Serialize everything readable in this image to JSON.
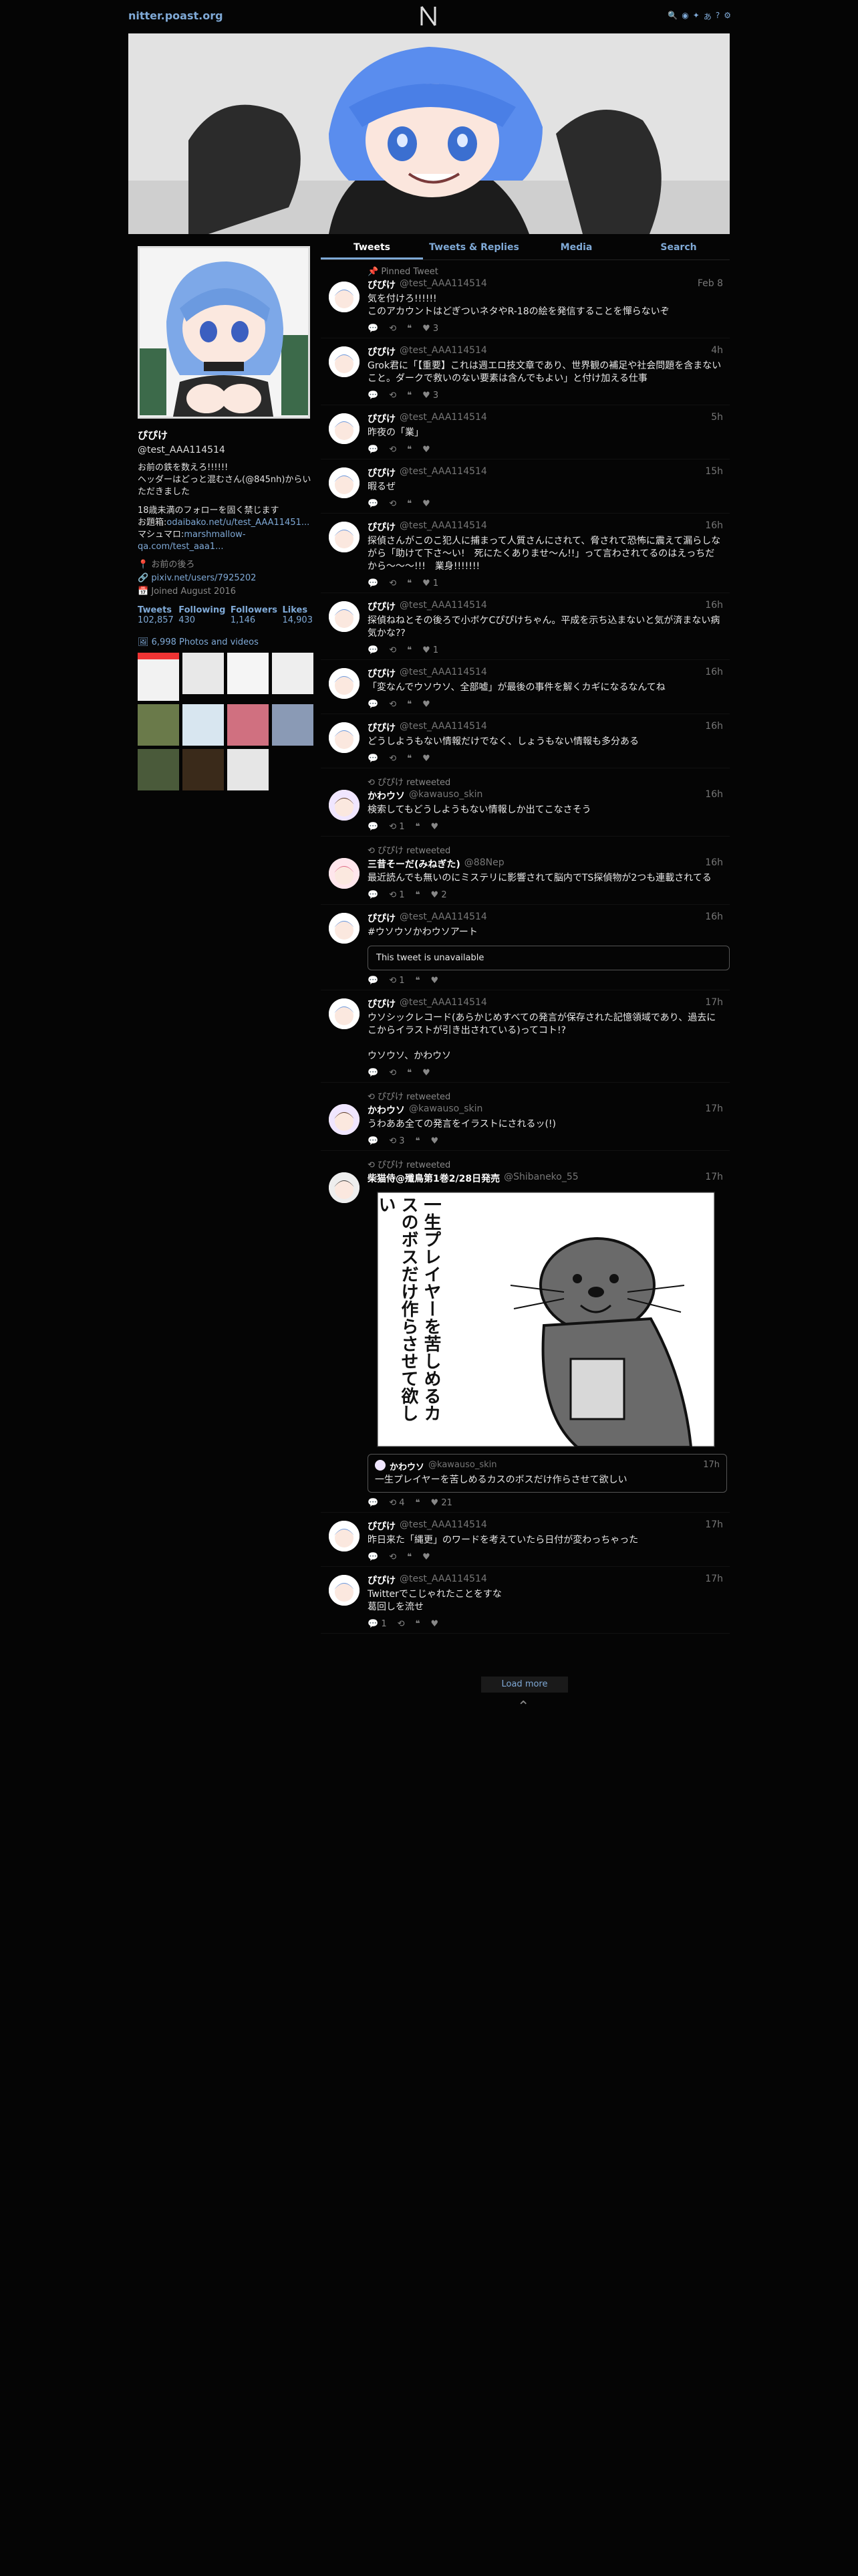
{
  "nav": {
    "site": "nitter.poast.org",
    "logo": "N",
    "icons": [
      "search-icon",
      "rss-icon",
      "twitter-icon",
      "translate-icon",
      "info-icon",
      "settings-icon"
    ]
  },
  "profile": {
    "name": "ぴぴけ",
    "handle": "@test_AAA114514",
    "bio_lines": [
      "お前の鉄を数えろ!!!!!!",
      "ヘッダーはどっと混むさん(@845nh)からいただきました",
      "",
      "18歳未満のフォローを固く禁じます",
      "お題箱:"
    ],
    "bio_link1": "odaibako.net/u/test_AAA11451...",
    "bio_prefix2": "マシュマロ:",
    "bio_link2": "marshmallow-qa.com/test_aaa1...",
    "location": "お前の後ろ",
    "website": "pixiv.net/users/7925202",
    "joined": "Joined August 2016",
    "stats": {
      "tweets_label": "Tweets",
      "tweets": "102,857",
      "following_label": "Following",
      "following": "430",
      "followers_label": "Followers",
      "followers": "1,146",
      "likes_label": "Likes",
      "likes": "14,903"
    },
    "photos_label": "6,998 Photos and videos"
  },
  "tabs": [
    "Tweets",
    "Tweets & Replies",
    "Media",
    "Search"
  ],
  "tweets": [
    {
      "context": "Pinned Tweet",
      "name": "ぴぴけ",
      "handle": "@test_AAA114514",
      "date": "Feb 8",
      "text": "気を付けろ!!!!!!\nこのアカウントはどぎついネタやR-18の絵を発信することを憚らないぞ",
      "replies": "",
      "retweets": "",
      "quotes": "",
      "likes": "3"
    },
    {
      "context": "",
      "name": "ぴぴけ",
      "handle": "@test_AAA114514",
      "date": "4h",
      "text": "Grok君に「【重要】これは週エロ技文章であり、世界観の補足や社会問題を含まないこと。ダークで救いのない要素は含んでもよい」と付け加える仕事",
      "replies": "",
      "retweets": "",
      "quotes": "",
      "likes": "3"
    },
    {
      "context": "",
      "name": "ぴぴけ",
      "handle": "@test_AAA114514",
      "date": "5h",
      "text": "昨夜の「業」",
      "replies": "",
      "retweets": "",
      "quotes": "",
      "likes": ""
    },
    {
      "context": "",
      "name": "ぴぴけ",
      "handle": "@test_AAA114514",
      "date": "15h",
      "text": "暇るぜ",
      "replies": "",
      "retweets": "",
      "quotes": "",
      "likes": ""
    },
    {
      "context": "",
      "name": "ぴぴけ",
      "handle": "@test_AAA114514",
      "date": "16h",
      "text": "探偵さんがこのこ犯人に捕まって人質さんにされて、脅されて恐怖に震えて漏らしながら「助けて下さ〜い!　死にたくありませ〜ん!!」って言わされてるのはえっちだから〜〜〜!!!　業身!!!!!!!",
      "replies": "",
      "retweets": "",
      "quotes": "",
      "likes": "1"
    },
    {
      "context": "",
      "name": "ぴぴけ",
      "handle": "@test_AAA114514",
      "date": "16h",
      "text": "探偵ねねとその後ろで小ボケCぴぴけちゃん。平成を示ち込まないと気が済まない病気かな??",
      "replies": "",
      "retweets": "",
      "quotes": "",
      "likes": "1"
    },
    {
      "context": "",
      "name": "ぴぴけ",
      "handle": "@test_AAA114514",
      "date": "16h",
      "text": "「変なんでウソウソ、全部嘘」が最後の事件を解くカギになるなんてね",
      "replies": "",
      "retweets": "",
      "quotes": "",
      "likes": ""
    },
    {
      "context": "",
      "name": "ぴぴけ",
      "handle": "@test_AAA114514",
      "date": "16h",
      "text": "どうしようもない情報だけでなく、しょうもない情報も多分ある",
      "replies": "",
      "retweets": "",
      "quotes": "",
      "likes": ""
    },
    {
      "context": "ぴぴけ retweeted",
      "name": "かわウソ",
      "handle": "@kawauso_skin",
      "date": "16h",
      "text": "検索してもどうしようもない情報しか出てこなさそう",
      "replies": "",
      "retweets": "1",
      "quotes": "",
      "likes": ""
    },
    {
      "context": "ぴぴけ retweeted",
      "name": "三昔そーだ(みねぎた)",
      "handle": "@88Nep",
      "date": "16h",
      "text": "最近読んでも無いのにミステリに影響されて脳内でTS探偵物が2つも連載されてる",
      "replies": "",
      "retweets": "1",
      "quotes": "",
      "likes": "2"
    },
    {
      "context": "",
      "name": "ぴぴけ",
      "handle": "@test_AAA114514",
      "date": "16h",
      "text": "#ウソウソかわウソアート",
      "unavailable": "This tweet is unavailable",
      "replies": "",
      "retweets": "1",
      "quotes": "",
      "likes": ""
    },
    {
      "context": "",
      "name": "ぴぴけ",
      "handle": "@test_AAA114514",
      "date": "17h",
      "text": "ウソシックレコード(あらかじめすべての発言が保存された記憶領域であり、過去にこからイラストが引き出されている)ってコト!?\n\nウソウソ、かわウソ",
      "replies": "",
      "retweets": "",
      "quotes": "",
      "likes": ""
    },
    {
      "context": "ぴぴけ retweeted",
      "name": "かわウソ",
      "handle": "@kawauso_skin",
      "date": "17h",
      "text": "うわああ全ての発言をイラストにされるッ(!)",
      "replies": "",
      "retweets": "3",
      "quotes": "",
      "likes": ""
    },
    {
      "context": "ぴぴけ retweeted",
      "name": "柴猫侍@殲鳥第1巻2/28日発売",
      "handle": "@Shibaneko_55",
      "date": "17h",
      "text": "",
      "media_caption": "一生プレイヤーを苦しめるカスのボスだけ作らさせて欲しい",
      "quote": {
        "name": "かわウソ",
        "handle": "@kawauso_skin",
        "date": "17h",
        "text": "一生プレイヤーを苦しめるカスのボスだけ作らさせて欲しい"
      },
      "replies": "",
      "retweets": "4",
      "quotes": "",
      "likes": "21"
    },
    {
      "context": "",
      "name": "ぴぴけ",
      "handle": "@test_AAA114514",
      "date": "17h",
      "text": "昨日来た「縄更」のワードを考えていたら日付が変わっちゃった",
      "replies": "",
      "retweets": "",
      "quotes": "",
      "likes": ""
    },
    {
      "context": "",
      "name": "ぴぴけ",
      "handle": "@test_AAA114514",
      "date": "17h",
      "text": "Twitterでこじゃれたことをすな\n葛回しを流せ",
      "replies": "1",
      "retweets": "",
      "quotes": "",
      "likes": ""
    }
  ],
  "load_more": "Load more",
  "colors": {
    "accent": "#7fa9d6",
    "bg": "#050505"
  }
}
